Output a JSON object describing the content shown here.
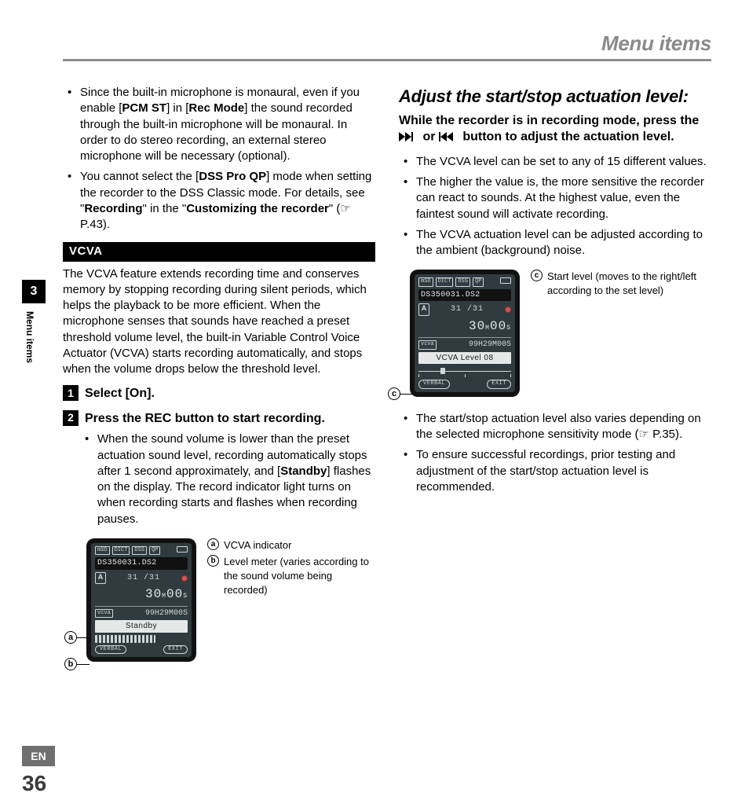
{
  "header": {
    "title": "Menu items"
  },
  "side": {
    "chapter": "3",
    "label": "Menu items",
    "lang": "EN",
    "page": "36"
  },
  "left": {
    "bullets": {
      "b1a": "Since the built-in microphone is monaural, even if you enable  [",
      "b1b": "PCM ST",
      "b1c": "] in [",
      "b1d": "Rec Mode",
      "b1e": "] the sound recorded through the built-in microphone will be monaural. In order to do stereo recording, an external stereo microphone will be necessary (optional).",
      "b2a": "You cannot select the [",
      "b2b": "DSS Pro QP",
      "b2c": "] mode when setting the recorder to the DSS Classic mode. For details, see \"",
      "b2d": "Recording",
      "b2e": "\" in the \"",
      "b2f": "Customizing the recorder",
      "b2g": "\" (☞ P.43)."
    },
    "band": "VCVA",
    "para1": "The VCVA feature extends recording time and conserves memory by stopping recording during silent periods, which helps the playback to be more efficient. When the microphone senses that sounds have reached a preset threshold volume level, the built-in Variable Control Voice Actuator (VCVA) starts recording automatically, and stops when the volume drops below the threshold level.",
    "step1_pre": "Select [",
    "step1_bold": "On",
    "step1_post": "].",
    "step1_num": "1",
    "step2_num": "2",
    "step2_text": "Press the REC button to start recording.",
    "sub1a": "When the sound volume is lower than the preset actuation sound level, recording automatically stops after 1 second approximately, and [",
    "sub1b": "Standby",
    "sub1c": "] flashes on the display. The record indicator light turns on when recording starts and flashes when recording pauses.",
    "device": {
      "top": {
        "i1": "mSD",
        "i2": "DICT",
        "i3": "DSS",
        "i4": "QP"
      },
      "fname": "DS350031.DS2",
      "folder": "A",
      "frac": "31 /31",
      "time": "30",
      "time_m": "M",
      "time_s1": "00",
      "time_s": "S",
      "tag": "vcva",
      "dur": "99H29M00S",
      "status": "Standby",
      "soft_l": "VERBAL",
      "soft_r": "EXIT"
    },
    "legend": {
      "a": "VCVA indicator",
      "b": "Level meter (varies according to the sound volume being recorded)"
    },
    "call_a": "a",
    "call_b": "b"
  },
  "right": {
    "h2": "Adjust the start/stop actuation level:",
    "h3a": "While the recorder is in recording mode, press the ",
    "h3b": " or ",
    "h3c": " button to adjust the actuation level.",
    "bullets_top": {
      "b1": "The VCVA level can be set to any of 15 different values.",
      "b2": "The higher the value is, the more sensitive the recorder can react to sounds. At the highest value, even the faintest sound will activate recording.",
      "b3": "The VCVA actuation level can be adjusted according to the ambient (background) noise."
    },
    "device": {
      "top": {
        "i1": "mSD",
        "i2": "DICT",
        "i3": "DSS",
        "i4": "QP"
      },
      "fname": "DS350031.DS2",
      "folder": "A",
      "frac": "31 /31",
      "time": "30",
      "time_m": "M",
      "time_s1": "00",
      "time_s": "S",
      "tag": "vcva",
      "dur": "99H29M00S",
      "status": "VCVA Level 08",
      "soft_l": "VERBAL",
      "soft_r": "EXIT"
    },
    "legend_c": "Start level (moves to the right/left according to the set level)",
    "call_c": "c",
    "bullets_bottom": {
      "b1": "The start/stop actuation level also varies depending on the selected microphone sensitivity mode (☞ P.35).",
      "b2": "To ensure successful recordings, prior testing and adjustment of the start/stop actuation level is recommended."
    }
  }
}
